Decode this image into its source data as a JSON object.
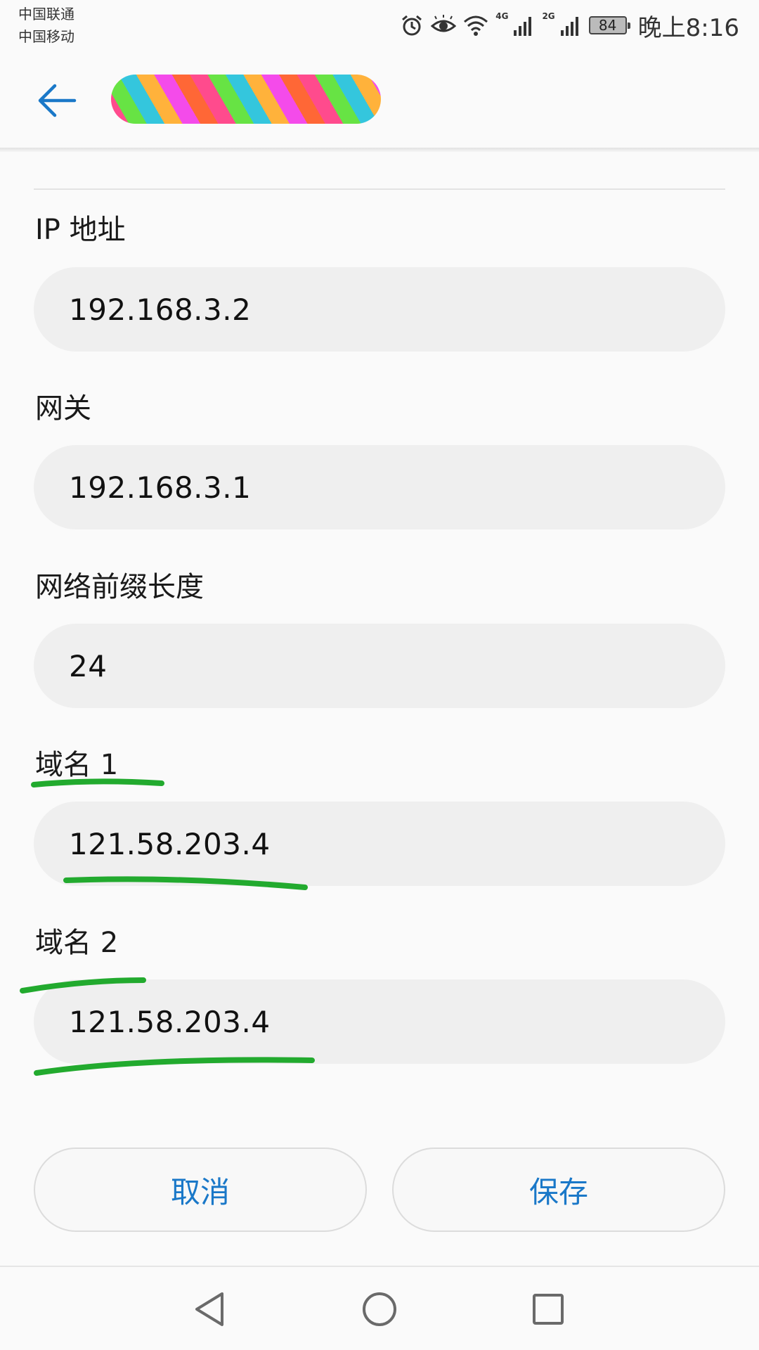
{
  "status_bar": {
    "carrier_1": "中国联通",
    "carrier_2": "中国移动",
    "network_1": "4G",
    "network_2": "2G",
    "battery": "84",
    "time": "晚上8:16",
    "icons": [
      "alarm-icon",
      "eye-comfort-icon",
      "wifi-icon",
      "signal-4g-icon",
      "signal-2g-icon",
      "battery-icon"
    ]
  },
  "toolbar": {
    "back_icon": "back-arrow-icon"
  },
  "form": {
    "ip_label": "IP 地址",
    "ip_value": "192.168.3.2",
    "gateway_label": "网关",
    "gateway_value": "192.168.3.1",
    "prefix_label": "网络前缀长度",
    "prefix_value": "24",
    "dns1_label": "域名 1",
    "dns1_value": "121.58.203.4",
    "dns2_label": "域名 2",
    "dns2_value": "121.58.203.4"
  },
  "actions": {
    "cancel_label": "取消",
    "save_label": "保存"
  },
  "colors": {
    "accent": "#1a78c8",
    "input_bg": "#efefef",
    "annotation": "#22aa2e"
  },
  "nav_bar": {
    "icons": [
      "nav-back-icon",
      "nav-home-icon",
      "nav-recent-icon"
    ]
  }
}
